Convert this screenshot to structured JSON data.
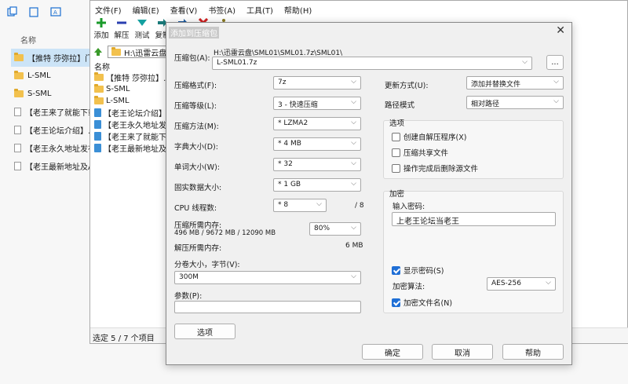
{
  "explorer": {
    "column_header": "名称",
    "items": [
      {
        "type": "folder",
        "name": "【推特 莎弥拉】门槛",
        "selected": true
      },
      {
        "type": "folder",
        "name": "L-SML",
        "selected": false
      },
      {
        "type": "folder",
        "name": "S-SML",
        "selected": false
      },
      {
        "type": "doc",
        "name": "【老王来了就能下载",
        "selected": false
      },
      {
        "type": "doc",
        "name": "【老王论坛介绍】.tx",
        "selected": false
      },
      {
        "type": "doc",
        "name": "【老王永久地址发布",
        "selected": false
      },
      {
        "type": "doc",
        "name": "【老王最新地址及A",
        "selected": false
      }
    ]
  },
  "sevenzip": {
    "menu": [
      "文件(F)",
      "编辑(E)",
      "查看(V)",
      "书签(A)",
      "工具(T)",
      "帮助(H)"
    ],
    "toolbar": [
      {
        "label": "添加",
        "icon": "add-icon",
        "color": "#1a9a2a"
      },
      {
        "label": "解压",
        "icon": "extract-icon",
        "color": "#2a3fb0"
      },
      {
        "label": "测试",
        "icon": "test-icon",
        "color": "#14a0a0"
      },
      {
        "label": "复制",
        "icon": "copy-icon",
        "color": "#1a7a7a"
      },
      {
        "label": "",
        "icon": "move-icon",
        "color": "#1a5aa0"
      },
      {
        "label": "",
        "icon": "delete-icon",
        "color": "#d02020"
      },
      {
        "label": "",
        "icon": "info-icon",
        "color": "#8a7a20"
      }
    ],
    "address": "H:\\迅雷云盘\\S",
    "list_header": "名称",
    "list": [
      {
        "type": "folder",
        "name": "【推特 莎弥拉】..."
      },
      {
        "type": "folder",
        "name": "S-SML"
      },
      {
        "type": "folder",
        "name": "L-SML"
      },
      {
        "type": "blue",
        "name": "【老王论坛介绍】..."
      },
      {
        "type": "blue",
        "name": "【老王永久地址发..."
      },
      {
        "type": "blue",
        "name": "【老王来了就能下..."
      },
      {
        "type": "blue",
        "name": "【老王最新地址及..."
      }
    ],
    "status": "选定 5 / 7 个项目"
  },
  "dialog": {
    "title": "添加到压缩包",
    "archive_label": "压缩包(A):",
    "archive_path": "H:\\迅雷云盘\\SML01\\SML01.7z\\SML01\\",
    "archive_name": "L-SML01.7z",
    "browse_label": "...",
    "left": {
      "format_label": "压缩格式(F):",
      "format_value": "7z",
      "level_label": "压缩等级(L):",
      "level_value": "3 - 快速压缩",
      "method_label": "压缩方法(M):",
      "method_value": "* LZMA2",
      "dict_label": "字典大小(D):",
      "dict_value": "* 4 MB",
      "word_label": "单词大小(W):",
      "word_value": "* 32",
      "solid_label": "固实数据大小:",
      "solid_value": "* 1 GB",
      "threads_label": "CPU 线程数:",
      "threads_value": "* 8",
      "threads_max": "/ 8",
      "mem_label": "压缩所需内存:",
      "mem_detail": "496 MB / 9672 MB / 12090 MB",
      "mem_percent": "80%",
      "dmem_label": "解压所需内存:",
      "dmem_value": "6 MB",
      "split_label": "分卷大小，字节(V):",
      "split_value": "300M",
      "params_label": "参数(P):",
      "params_value": "",
      "options_button": "选项"
    },
    "right": {
      "update_label": "更新方式(U):",
      "update_value": "添加并替换文件",
      "path_label": "路径模式",
      "path_value": "相对路径",
      "options_title": "选项",
      "options": [
        {
          "label": "创建自解压程序(X)",
          "checked": false
        },
        {
          "label": "压缩共享文件",
          "checked": false
        },
        {
          "label": "操作完成后删除源文件",
          "checked": false
        }
      ],
      "encrypt_title": "加密",
      "password_label": "输入密码:",
      "password_value": "上老王论坛当老王",
      "show_password": {
        "label": "显示密码(S)",
        "checked": true
      },
      "enc_method_label": "加密算法:",
      "enc_method_value": "AES-256",
      "encrypt_names": {
        "label": "加密文件名(N)",
        "checked": true
      }
    },
    "buttons": {
      "ok": "确定",
      "cancel": "取消",
      "help": "帮助"
    }
  }
}
